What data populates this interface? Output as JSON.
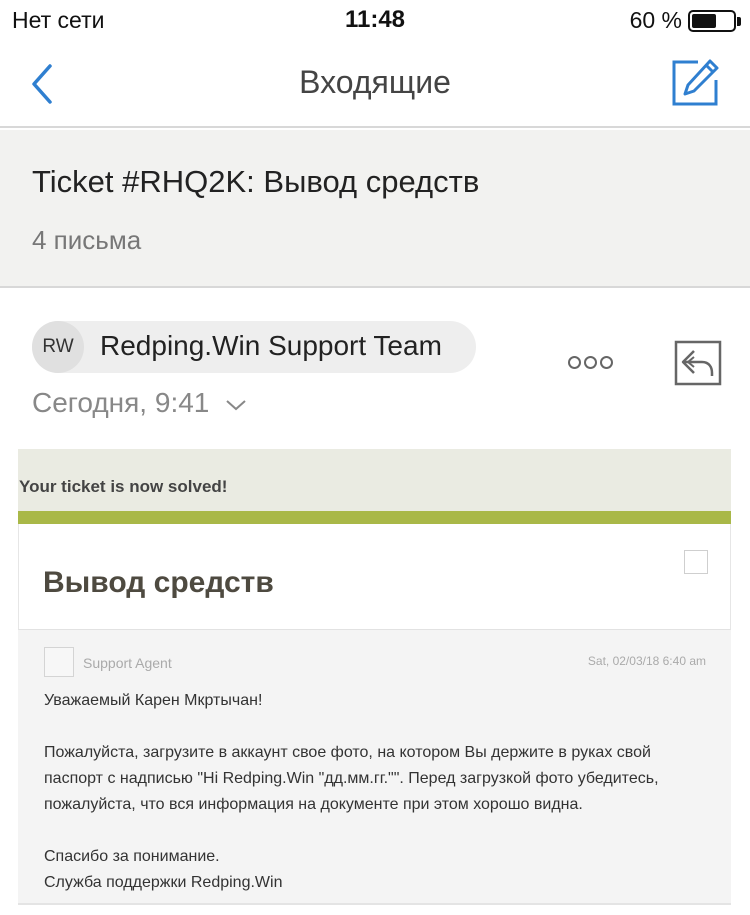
{
  "status_bar": {
    "carrier": "Нет сети",
    "time": "11:48",
    "battery_text": "60 %",
    "battery_level": 0.6
  },
  "nav": {
    "title": "Входящие",
    "back_icon": "chevron-left-icon",
    "compose_icon": "compose-icon",
    "accent_color": "#2f7fd0"
  },
  "thread": {
    "subject": "Ticket #RHQ2K: Вывод средств",
    "count": "4 письма"
  },
  "message": {
    "avatar_initials": "RW",
    "sender": "Redping.Win Support Team",
    "date": "Сегодня, 9:41",
    "more_icon": "more-dots-icon",
    "reply_icon": "reply-icon"
  },
  "email": {
    "banner": "Your ticket is now solved!",
    "banner_color": "#a9b848",
    "heading": "Вывод средств",
    "agent": "Support Agent",
    "date": "Sat, 02/03/18 6:40 am",
    "greeting": "Уважаемый Карен Мкртычан!",
    "paragraph": "Пожалуйста, загрузите в аккаунт свое фото, на котором Вы держите в руках свой паспорт с надписью \"Hi Redping.Win \"дд.мм.гг.\"\". Перед загрузкой фото убедитесь, пожалуйста, что вся информация на документе при этом хорошо видна.",
    "closing": "Спасибо за понимание.",
    "signature": "Служба поддержки Redping.Win"
  }
}
